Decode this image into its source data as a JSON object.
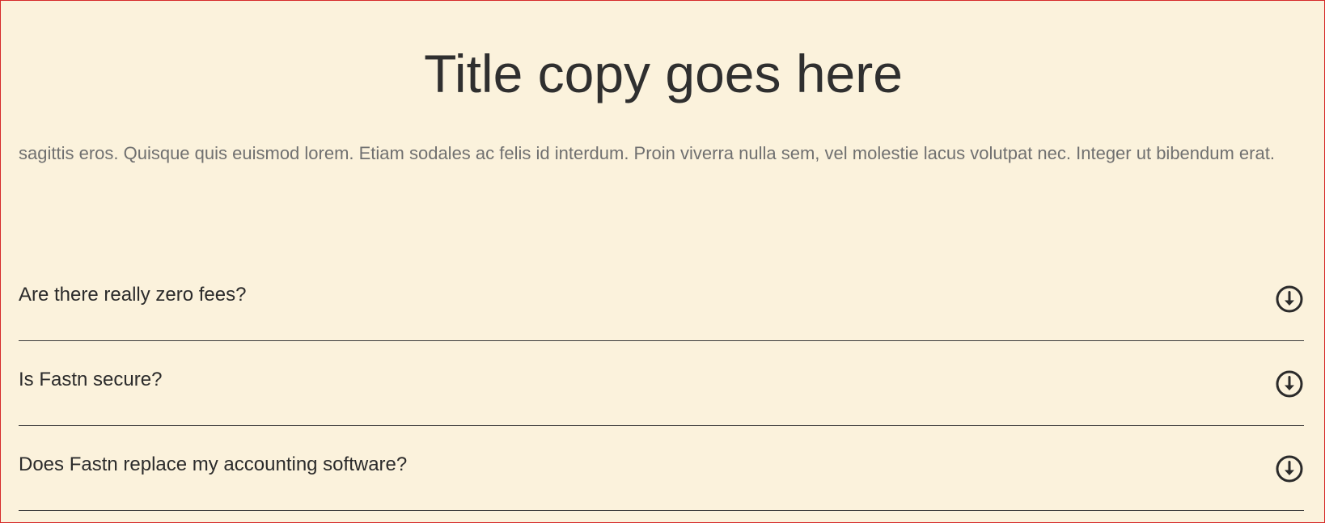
{
  "header": {
    "title": "Title copy goes here",
    "intro": "sagittis eros. Quisque quis euismod lorem. Etiam sodales ac felis id interdum. Proin viverra nulla sem, vel molestie lacus volutpat nec. Integer ut bibendum erat."
  },
  "faq": {
    "items": [
      {
        "question": "Are there really zero fees?",
        "icon": "arrow-down-circle-icon"
      },
      {
        "question": "Is Fastn secure?",
        "icon": "arrow-down-circle-icon"
      },
      {
        "question": "Does Fastn replace my accounting software?",
        "icon": "arrow-down-circle-icon"
      }
    ]
  },
  "colors": {
    "background": "#fbf2dc",
    "title": "#2f2f2f",
    "intro_text": "#707070",
    "divider": "#3a3a3a",
    "frame_border": "#d62a2a"
  }
}
